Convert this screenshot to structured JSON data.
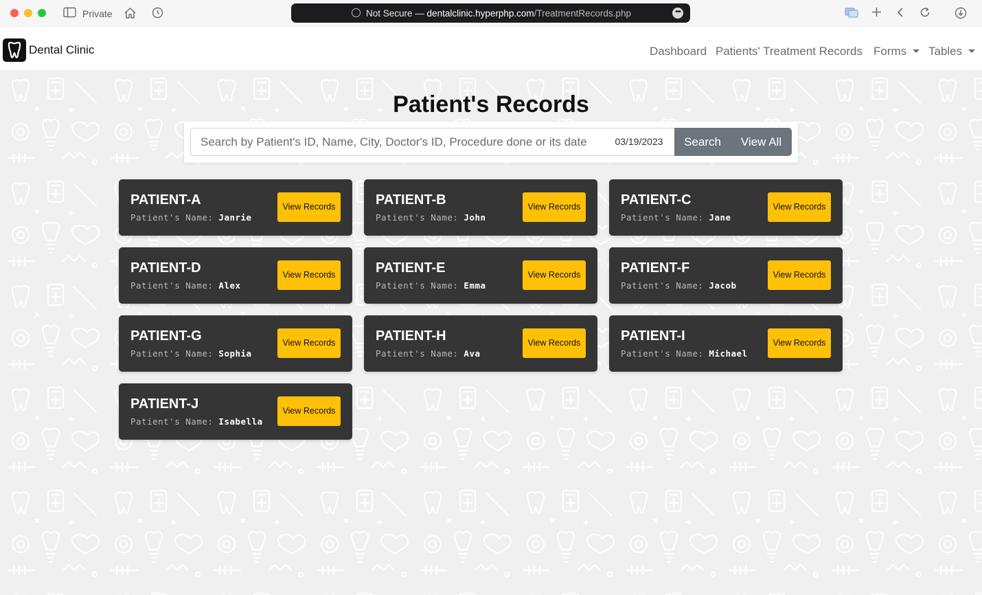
{
  "browser": {
    "private_label": "Private",
    "url_prefix": "Not Secure — ",
    "url_host": "dentalclinic.hyperphp.com",
    "url_path": "/TreatmentRecords.php"
  },
  "navbar": {
    "brand": "Dental Clinic",
    "items": [
      {
        "label": "Dashboard"
      },
      {
        "label": "Patients' Treatment Records"
      },
      {
        "label": "Forms"
      },
      {
        "label": "Tables"
      }
    ]
  },
  "page": {
    "title": "Patient's Records"
  },
  "search": {
    "placeholder": "Search by Patient's ID, Name, City, Doctor's ID, Procedure done or its date",
    "date_value": "03/19/2023",
    "search_label": "Search",
    "view_all_label": "View All"
  },
  "card_labels": {
    "name_label": "Patient's Name:",
    "button_label": "View Records"
  },
  "patients": [
    {
      "id": "PATIENT-A",
      "name": "Janrie"
    },
    {
      "id": "PATIENT-B",
      "name": "John"
    },
    {
      "id": "PATIENT-C",
      "name": "Jane"
    },
    {
      "id": "PATIENT-D",
      "name": "Alex"
    },
    {
      "id": "PATIENT-E",
      "name": "Emma"
    },
    {
      "id": "PATIENT-F",
      "name": "Jacob"
    },
    {
      "id": "PATIENT-G",
      "name": "Sophia"
    },
    {
      "id": "PATIENT-H",
      "name": "Ava"
    },
    {
      "id": "PATIENT-I",
      "name": "Michael"
    },
    {
      "id": "PATIENT-J",
      "name": "Isabella"
    }
  ]
}
